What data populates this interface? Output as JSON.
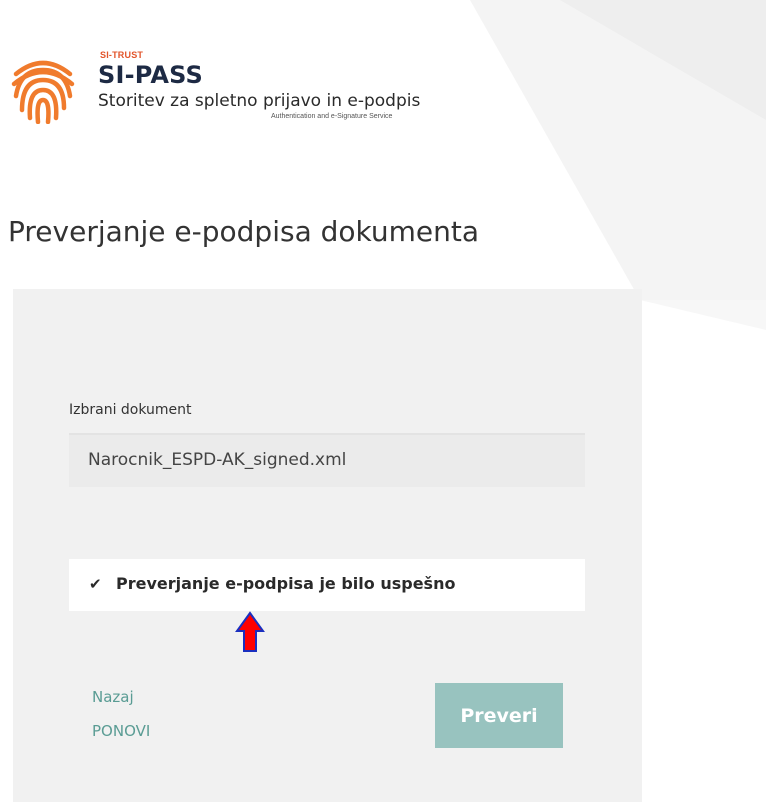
{
  "brand": {
    "small_label": "SI-TRUST",
    "name": "SI-PASS",
    "tagline": "Storitev za spletno prijavo in e-podpis",
    "subtagline": "Authentication and e-Signature Service",
    "logo_icon": "fingerprint-icon",
    "logo_color": "#f07b2d"
  },
  "page": {
    "title": "Preverjanje e-podpisa dokumenta"
  },
  "form": {
    "document_label": "Izbrani dokument",
    "document_value": "Narocnik_ESPD-AK_signed.xml"
  },
  "status": {
    "icon": "check-icon",
    "text": "Preverjanje e-podpisa je bilo uspešno"
  },
  "annotation": {
    "icon": "red-up-arrow-icon",
    "fill": "#ff0000",
    "outline": "#1a2fbf"
  },
  "actions": {
    "back_label": "Nazaj",
    "repeat_label": "PONOVI",
    "verify_label": "Preveri"
  },
  "colors": {
    "accent": "#98c3bf",
    "link": "#5a9c94",
    "panel": "#f1f1f1"
  }
}
